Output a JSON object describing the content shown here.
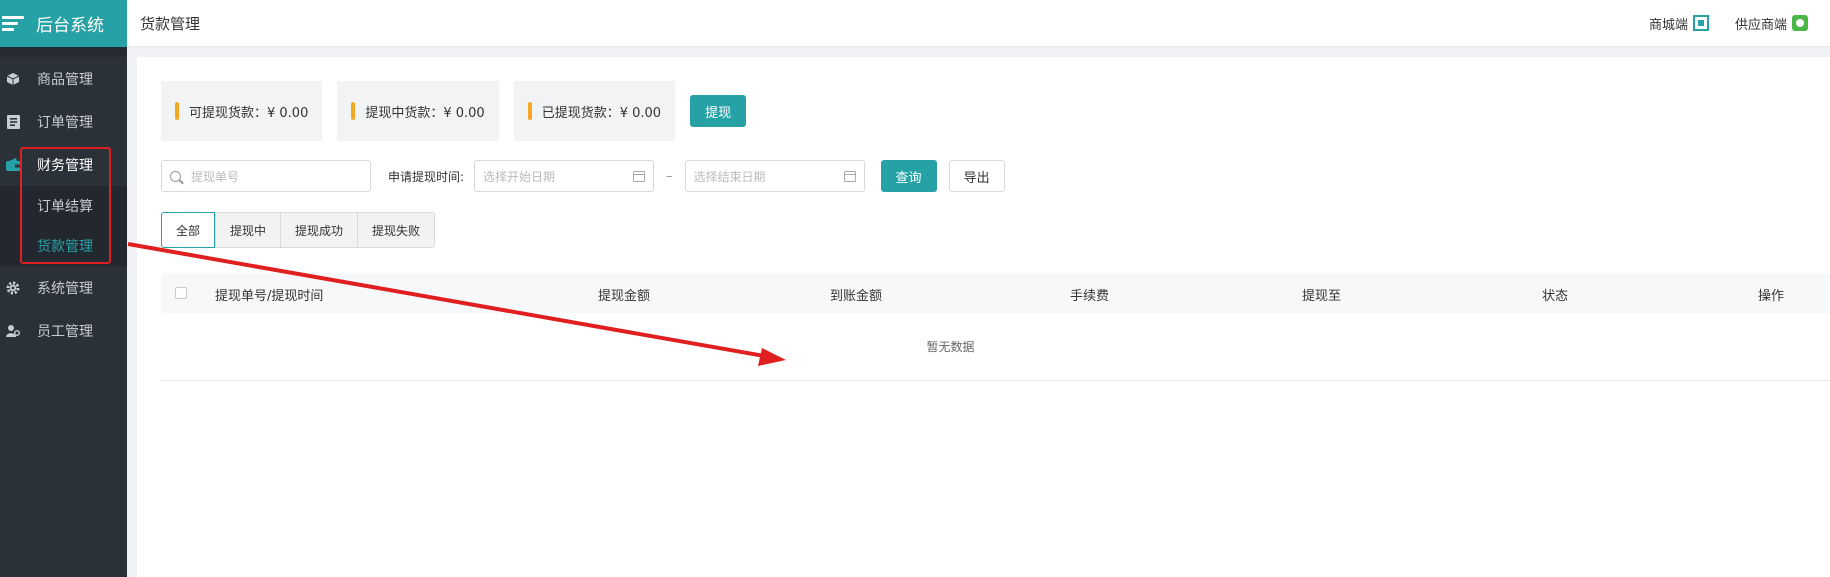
{
  "app": {
    "title": "后台系统"
  },
  "sidebar": {
    "items": [
      {
        "label": "商品管理",
        "icon": "cube-icon"
      },
      {
        "label": "订单管理",
        "icon": "list-icon"
      },
      {
        "label": "财务管理",
        "icon": "wallet-icon"
      },
      {
        "label": "订单结算"
      },
      {
        "label": "货款管理"
      },
      {
        "label": "系统管理",
        "icon": "gear-icon"
      },
      {
        "label": "员工管理",
        "icon": "users-icon"
      }
    ]
  },
  "header": {
    "page_title": "货款管理",
    "mall_link": "商城端",
    "supplier_link": "供应商端"
  },
  "stats": {
    "available": "可提现货款：¥ 0.00",
    "pending": "提现中货款：¥ 0.00",
    "withdrawn": "已提现货款：¥ 0.00",
    "withdraw_button": "提现"
  },
  "filters": {
    "search_placeholder": "提现单号",
    "date_label": "申请提现时间:",
    "start_placeholder": "选择开始日期",
    "separator": "–",
    "end_placeholder": "选择结束日期",
    "query_button": "查询",
    "export_button": "导出"
  },
  "tabs": [
    "全部",
    "提现中",
    "提现成功",
    "提现失败"
  ],
  "table": {
    "columns": [
      "提现单号/提现时间",
      "提现金额",
      "到账金额",
      "手续费",
      "提现至",
      "状态",
      "操作"
    ],
    "empty_text": "暂无数据"
  },
  "colors": {
    "accent": "#26a2a6",
    "sidebar": "#2b3139",
    "highlight": "#e02020",
    "stat_bar": "#f5a623"
  }
}
